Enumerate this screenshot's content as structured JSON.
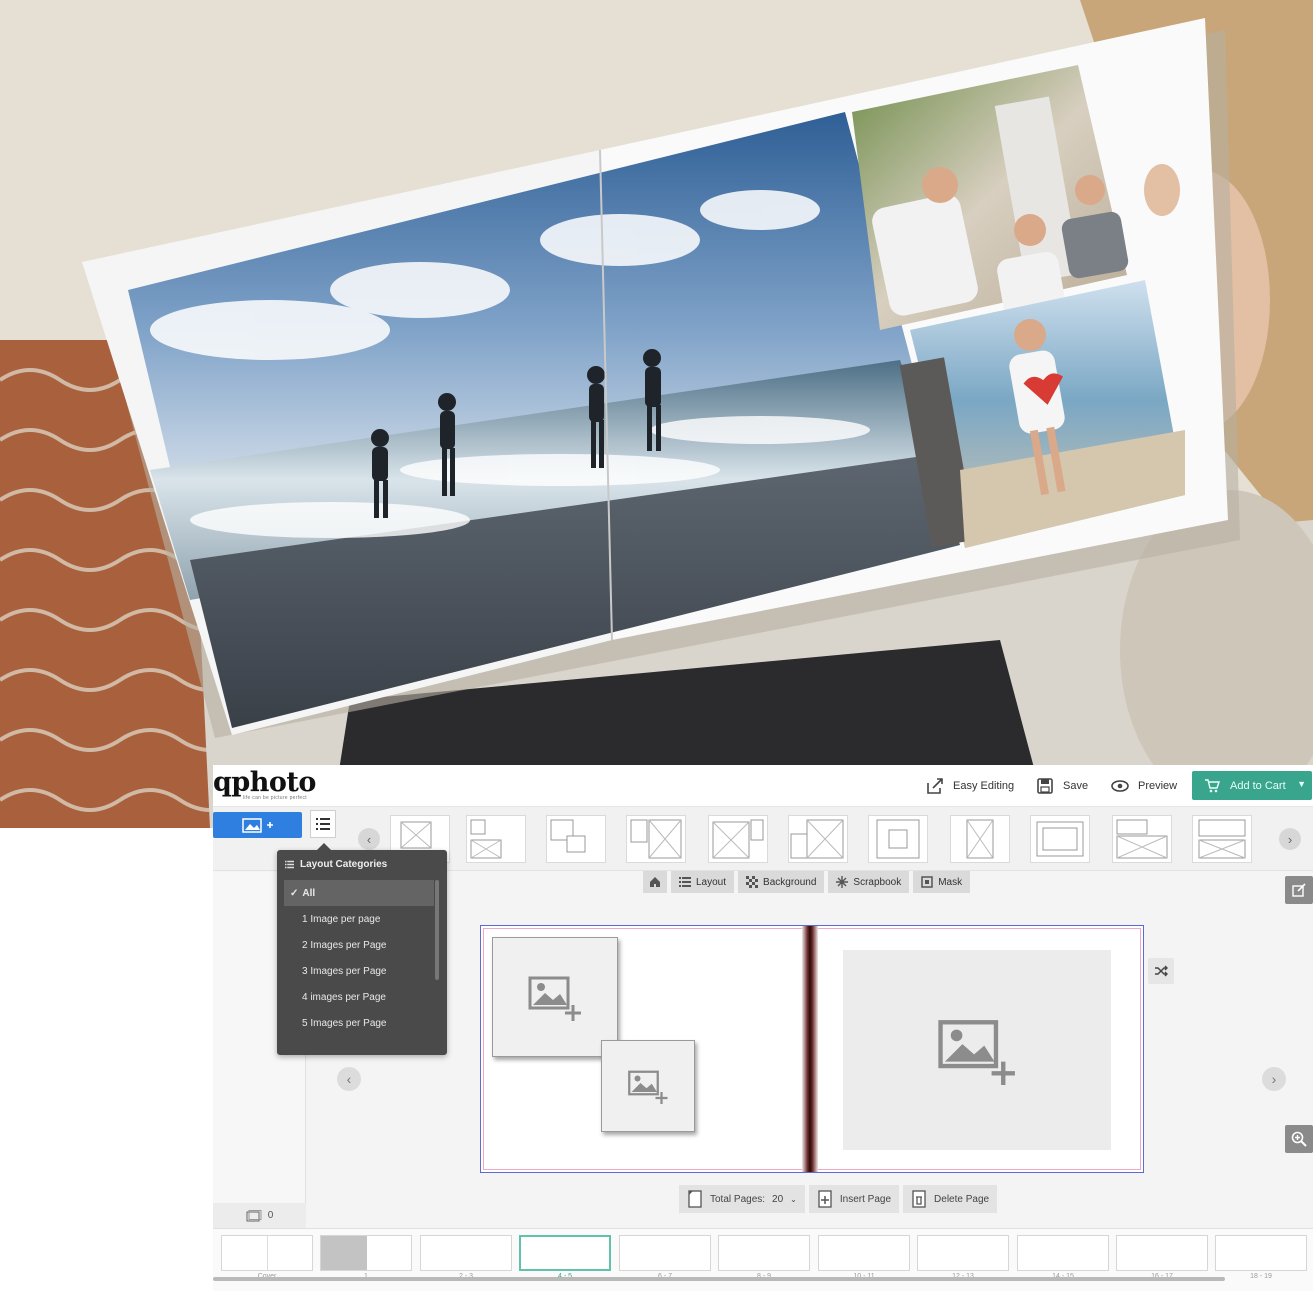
{
  "app": {
    "logo": "qphoto",
    "logo_tagline": "life can be picture perfect"
  },
  "topbar": {
    "easy_editing": "Easy Editing",
    "save": "Save",
    "preview": "Preview",
    "add_to_cart": "Add to Cart"
  },
  "dropdown": {
    "title": "Layout Categories",
    "items": [
      "All",
      "1 Image per page",
      "2 Images per Page",
      "3 Images per Page",
      "4 images per Page",
      "5 Images per Page"
    ],
    "selected": "All"
  },
  "toolbar": {
    "layout": "Layout",
    "background": "Background",
    "scrapbook": "Scrapbook",
    "mask": "Mask"
  },
  "pages_bar": {
    "total_pages_label": "Total Pages:",
    "total_pages_value": "20",
    "insert_page": "Insert Page",
    "delete_page": "Delete Page"
  },
  "photo_count": "0",
  "page_thumbs": [
    {
      "label": "Cover"
    },
    {
      "label": "1"
    },
    {
      "label": "2 - 3"
    },
    {
      "label": "4 - 5"
    },
    {
      "label": "6 - 7"
    },
    {
      "label": "8 - 9"
    },
    {
      "label": "10 - 11"
    },
    {
      "label": "12 - 13"
    },
    {
      "label": "14 - 15"
    },
    {
      "label": "16 - 17"
    },
    {
      "label": "18 - 19"
    }
  ],
  "colors": {
    "accent_green": "#3aa58d",
    "accent_blue": "#2f7fe0",
    "dropdown_bg": "#4a4a4a"
  }
}
